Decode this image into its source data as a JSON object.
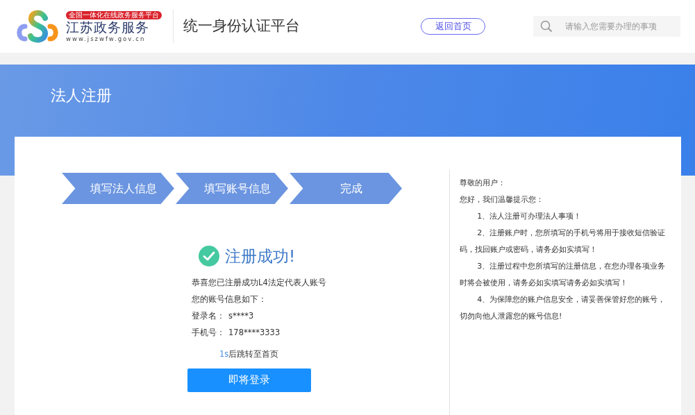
{
  "header": {
    "badge": "全国一体化在线政务服务平台",
    "site_name": "江苏政务服务",
    "site_url": "www.jszwfw.gov.cn",
    "platform_title": "统一身份认证平台",
    "home_button": "返回首页",
    "search": {
      "placeholder": "请输入您需要办理的事项"
    }
  },
  "banner": {
    "title": "法人注册"
  },
  "steps": [
    {
      "label": "填写法人信息",
      "done": true
    },
    {
      "label": "填写账号信息",
      "done": true
    },
    {
      "label": "完成",
      "done": true
    }
  ],
  "result": {
    "title": "注册成功!",
    "message": "恭喜您已注册成功L4法定代表人账号",
    "info_heading": "您的账号信息如下：",
    "fields": [
      {
        "label": "登录名：",
        "value": "s****3"
      },
      {
        "label": "手机号：",
        "value": "178****3333"
      }
    ],
    "countdown": "1s",
    "redirect_text": "后跳转至首页",
    "login_button": "即将登录"
  },
  "notice": {
    "greeting": "尊敬的用户：",
    "intro": "您好，我们温馨提示您：",
    "items": [
      "1、法人注册可办理法人事项！",
      "2、注册账户时，您所填写的手机号将用于接收短信验证码，找回账户或密码，请务必如实填写！",
      "3、注册过程中您所填写的注册信息，在您办理各项业务时将会被使用，请务必如实填写请务必如实填写！",
      "4、为保障您的账户信息安全，请妥善保管好您的账号，切勿向他人泄露您的账号信息!"
    ]
  }
}
